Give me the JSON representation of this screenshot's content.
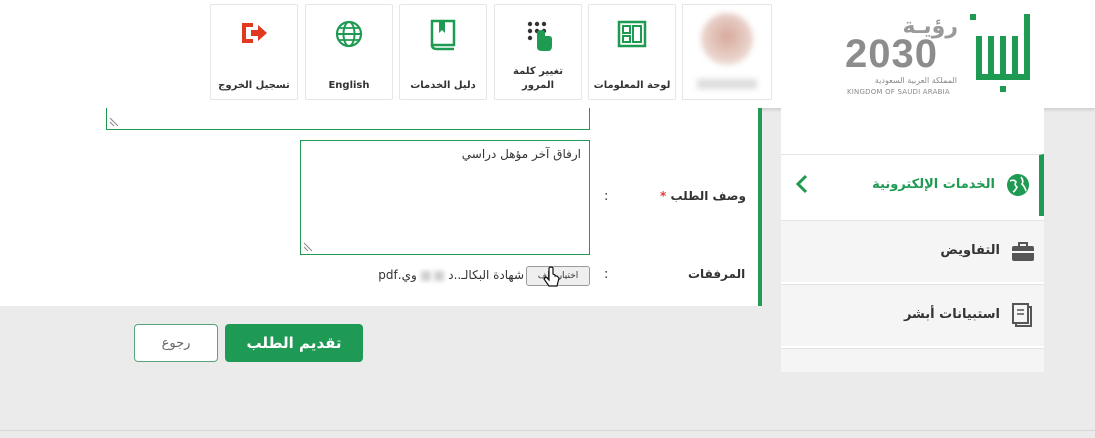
{
  "header": {
    "nav": [
      {
        "label": "تسجيل الخروج",
        "icon": "logout-icon",
        "color": "#e0391f"
      },
      {
        "label": "English",
        "icon": "globe-icon",
        "color": "#1f9a52"
      },
      {
        "label": "دليل الخدمات",
        "icon": "book-icon",
        "color": "#1f9a52"
      },
      {
        "label": "تغيير كلمة المرور",
        "icon": "keypad-icon",
        "color": "#1f9a52"
      },
      {
        "label": "لوحة المعلومات",
        "icon": "dashboard-icon",
        "color": "#1f9a52"
      }
    ],
    "vision": {
      "arabic": "رؤيـة",
      "year": "2030",
      "kingdom_ar": "المملكة العربية السعودية",
      "kingdom_en": "KINGDOM OF SAUDI ARABIA"
    }
  },
  "form": {
    "description_label": "وصف الطلب",
    "required_mark": "*",
    "colon": ":",
    "description_value": "ارفاق آخر مؤهل دراسي",
    "attachments_label": "المرفقات",
    "file_button": "اختيار ملف",
    "file_name_start": "شهادة البكالـ..د",
    "file_name_end": "وي.pdf"
  },
  "actions": {
    "submit": "تقديم الطلب",
    "back": "رجوع"
  },
  "sidebar": {
    "items": [
      {
        "label": "الخدمات الإلكترونية",
        "icon": "globe-icon",
        "active": true
      },
      {
        "label": "التفاويض",
        "icon": "briefcase-icon",
        "active": false
      },
      {
        "label": "استبيانات أبشر",
        "icon": "clipboard-icon",
        "active": false
      }
    ]
  },
  "colors": {
    "accent": "#1f9a52",
    "logout": "#e0391f"
  }
}
